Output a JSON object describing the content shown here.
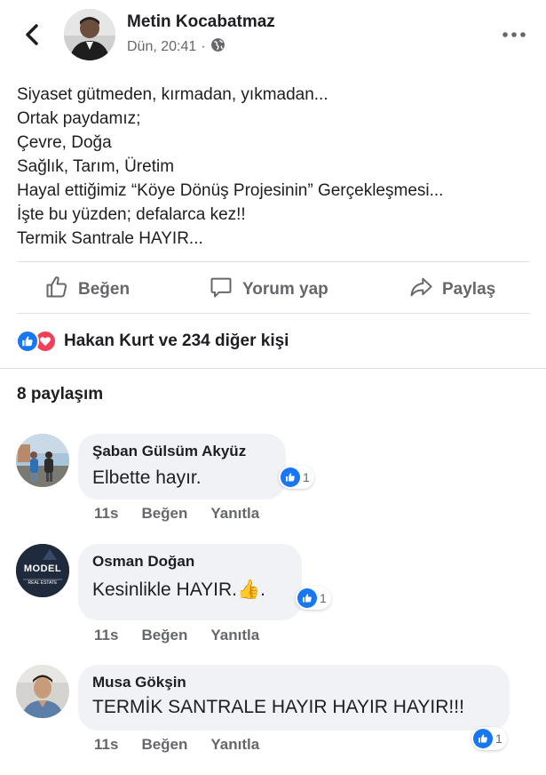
{
  "header": {
    "author": "Metin Kocabatmaz",
    "time": "Dün, 20:41",
    "separator": "·"
  },
  "post": {
    "lines": [
      "Siyaset gütmeden, kırmadan, yıkmadan...",
      "Ortak paydamız;",
      "Çevre, Doğa",
      "Sağlık, Tarım, Üretim",
      "Hayal ettiğimiz “Köye Dönüş Projesinin” Gerçekleşmesi...",
      "İşte bu yüzden; defalarca kez!!",
      "Termik Santrale HAYIR..."
    ]
  },
  "actions": {
    "like": "Beğen",
    "comment": "Yorum yap",
    "share": "Paylaş"
  },
  "reactions": {
    "text": "Hakan Kurt ve 234 diğer kişi"
  },
  "shares": "8 paylaşım",
  "comments": [
    {
      "name": "Şaban Gülsüm Akyüz",
      "text": "Elbette hayır.",
      "time": "11s",
      "like": "Beğen",
      "reply": "Yanıtla",
      "likes": "1"
    },
    {
      "name": "Osman Doğan",
      "text": "Kesinlikle HAYIR.",
      "emoji": "👍",
      "text_end": ".",
      "time": "11s",
      "like": "Beğen",
      "reply": "Yanıtla",
      "likes": "1",
      "avatar_text": "MODEL",
      "avatar_sub": "REAL ESTATE"
    },
    {
      "name": "Musa Gökşin",
      "text": "TERMİK SANTRALE HAYIR HAYIR HAYIR!!!",
      "time": "11s",
      "like": "Beğen",
      "reply": "Yanıtla",
      "likes": "1"
    }
  ],
  "colors": {
    "like_blue": "#1877f2",
    "love_red": "#f33e58",
    "secondary_text": "#65676b",
    "bubble_bg": "#f0f2f5"
  }
}
